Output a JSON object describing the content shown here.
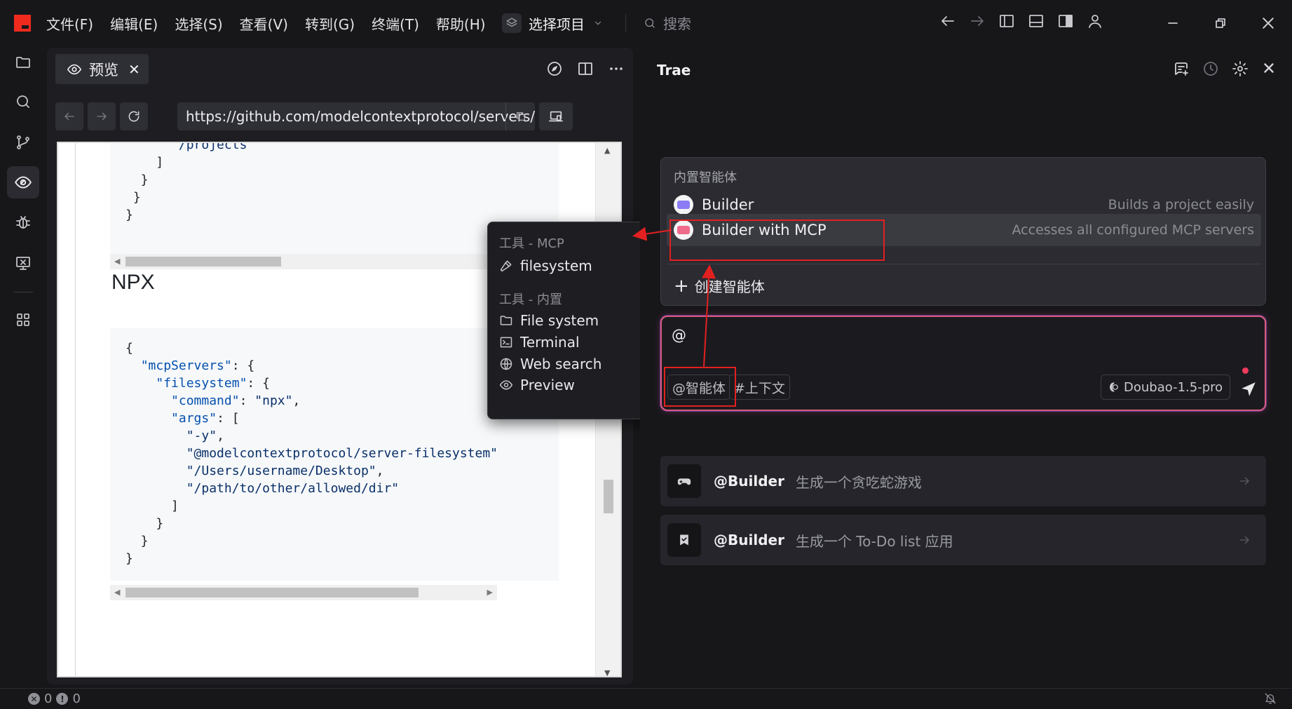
{
  "menu": [
    "文件(F)",
    "编辑(E)",
    "选择(S)",
    "查看(V)",
    "转到(G)",
    "终端(T)",
    "帮助(H)"
  ],
  "project": {
    "label": "选择项目"
  },
  "search": {
    "placeholder": "搜索"
  },
  "preview": {
    "tab_label": "预览",
    "url": "https://github.com/modelcontextprotocol/servers/tree/mai...",
    "heading_npx": "NPX"
  },
  "code_top": [
    "      \"/projects\"",
    "    ]",
    "  }",
    " }",
    "}"
  ],
  "code_main": [
    "{",
    "  \"mcpServers\": {",
    "    \"filesystem\": {",
    "      \"command\": \"npx\",",
    "      \"args\": [",
    "        \"-y\",",
    "        \"@modelcontextprotocol/server-filesystem\"",
    "        \"/Users/username/Desktop\",",
    "        \"/path/to/other/allowed/dir\"",
    "      ]",
    "    }",
    "  }",
    "}"
  ],
  "tools_popup": {
    "mcp_header": "工具 - MCP",
    "mcp_items": [
      "filesystem"
    ],
    "builtin_header": "工具 - 内置",
    "builtin_items": [
      "File system",
      "Terminal",
      "Web search",
      "Preview"
    ]
  },
  "trae": {
    "title": "Trae",
    "agents_header": "内置智能体",
    "agents": [
      {
        "name": "Builder",
        "desc": "Builds a project easily",
        "color": "#8b7cf6"
      },
      {
        "name": "Builder with MCP",
        "desc": "Accesses all configured MCP servers",
        "color": "#f06a8a"
      }
    ],
    "create_agent": "创建智能体",
    "input_value": "@",
    "chip_agent": "@智能体",
    "chip_context": "#上下文",
    "model": "Doubao-1.5-pro",
    "suggestions": [
      {
        "at": "@Builder",
        "text": "生成一个贪吃蛇游戏",
        "icon": "gamepad-icon"
      },
      {
        "at": "@Builder",
        "text": "生成一个 To-Do list 应用",
        "icon": "checklist-icon"
      }
    ]
  },
  "status": {
    "errors": "0",
    "warnings": "0"
  },
  "colors": {
    "accent_red": "#e32020",
    "input_border": "#d65a7f",
    "logo": "#f02a1d"
  }
}
